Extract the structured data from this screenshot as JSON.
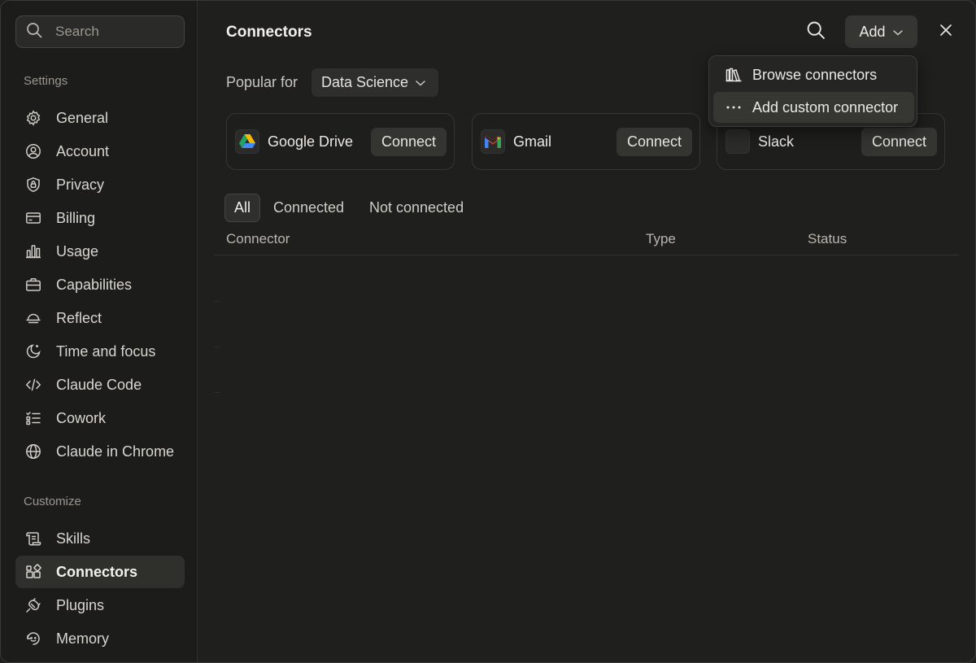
{
  "search": {
    "placeholder": "Search"
  },
  "sidebar": {
    "settings_title": "Settings",
    "settings_items": [
      {
        "label": "General",
        "icon": "gear-icon"
      },
      {
        "label": "Account",
        "icon": "user-circle-icon"
      },
      {
        "label": "Privacy",
        "icon": "shield-lock-icon"
      },
      {
        "label": "Billing",
        "icon": "credit-card-icon"
      },
      {
        "label": "Usage",
        "icon": "bar-chart-icon"
      },
      {
        "label": "Capabilities",
        "icon": "briefcase-icon"
      },
      {
        "label": "Reflect",
        "icon": "sunset-icon"
      },
      {
        "label": "Time and focus",
        "icon": "moon-sparkle-icon"
      },
      {
        "label": "Claude Code",
        "icon": "code-icon"
      },
      {
        "label": "Cowork",
        "icon": "checklist-icon"
      },
      {
        "label": "Claude in Chrome",
        "icon": "globe-icon"
      }
    ],
    "customize_title": "Customize",
    "customize_items": [
      {
        "label": "Skills",
        "icon": "scroll-icon"
      },
      {
        "label": "Connectors",
        "icon": "connectors-icon",
        "active": true
      },
      {
        "label": "Plugins",
        "icon": "plug-icon"
      },
      {
        "label": "Memory",
        "icon": "memory-icon"
      }
    ]
  },
  "main": {
    "title": "Connectors",
    "add_label": "Add",
    "popular_label": "Popular for",
    "popular_selected": "Data Science",
    "cards": [
      {
        "name": "Google Drive",
        "action": "Connect",
        "icon": "google-drive-icon"
      },
      {
        "name": "Gmail",
        "action": "Connect",
        "icon": "gmail-icon"
      },
      {
        "name": "Slack",
        "action": "Connect",
        "icon": "slack-icon"
      }
    ],
    "filters": [
      "All",
      "Connected",
      "Not connected"
    ],
    "columns": [
      "Connector",
      "Type",
      "Status"
    ]
  },
  "menu": {
    "items": [
      {
        "label": "Browse connectors",
        "icon": "library-icon"
      },
      {
        "label": "Add custom connector",
        "icon": "more-dots-icon"
      }
    ]
  }
}
